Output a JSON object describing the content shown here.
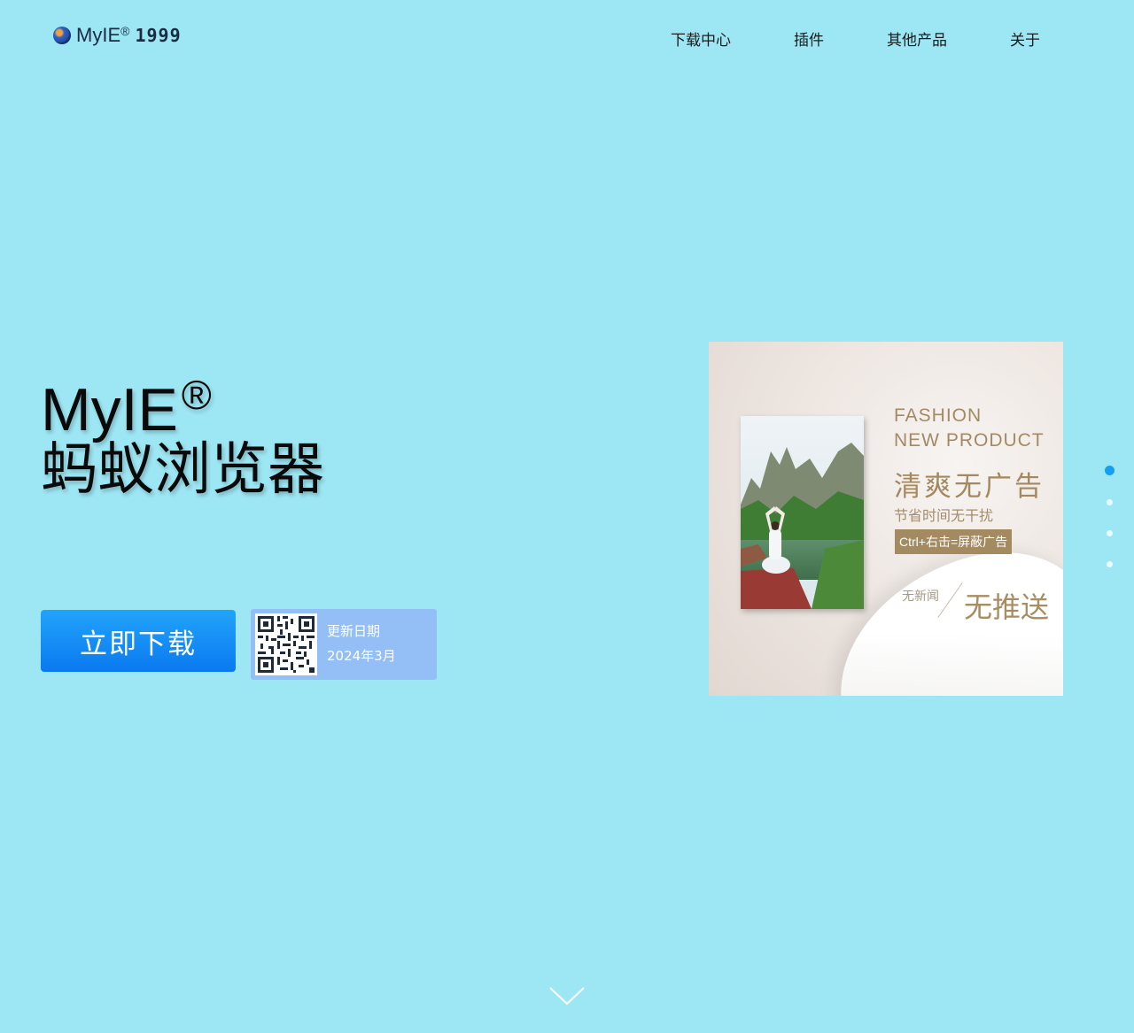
{
  "header": {
    "logo_text": "MyIE",
    "logo_reg": "®",
    "logo_year": "1999",
    "nav": [
      {
        "label": "下载中心"
      },
      {
        "label": "插件"
      },
      {
        "label": "其他产品"
      },
      {
        "label": "关于"
      }
    ]
  },
  "hero": {
    "brand": "MyIE",
    "brand_reg": "®",
    "subtitle": "蚂蚁浏览器",
    "download_label": "立即下载",
    "update_label": "更新日期",
    "update_date": "2024年3月"
  },
  "ad": {
    "line1": "FASHION",
    "line2": "NEW PRODUCT",
    "headline": "清爽无广告",
    "sub": "节省时间无干扰",
    "tag": "Ctrl+右击=屏蔽广告",
    "small": "无新闻",
    "big": "无推送"
  },
  "carousel": {
    "total": 4,
    "active_index": 0
  },
  "colors": {
    "background": "#9de6f3",
    "button": "#0a79f0",
    "active_dot": "#169ff0",
    "ad_gold": "#a48a60"
  },
  "icons": {
    "logo": "globe-icon",
    "scroll": "chevron-down-icon"
  }
}
